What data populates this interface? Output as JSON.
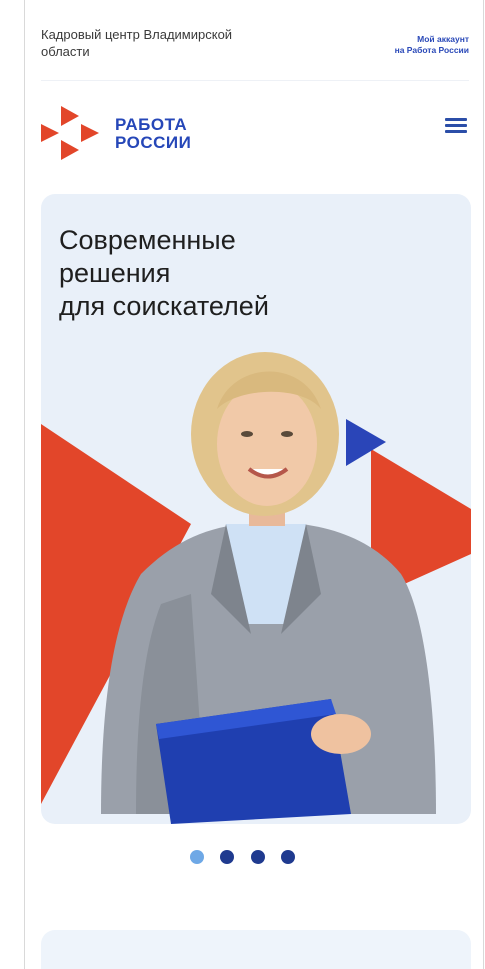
{
  "topbar": {
    "org_name": "Кадровый центр Владимирской области",
    "account_link_line1": "Мой аккаунт",
    "account_link_line2": "на Работа России"
  },
  "header": {
    "logo_line1": "РАБОТА",
    "logo_line2": "РОССИИ",
    "menu_icon": "hamburger-menu-icon"
  },
  "banner": {
    "title_line1": "Современные",
    "title_line2": "решения",
    "title_line3": "для соискателей"
  },
  "pager": {
    "slide_count": 4,
    "active_index": 0
  },
  "colors": {
    "brand_blue": "#2647b8",
    "brand_red": "#e2462a",
    "banner_bg": "#e9f0f9",
    "dot_active": "#6ea8e6",
    "dot_inactive": "#1f3a8f"
  }
}
